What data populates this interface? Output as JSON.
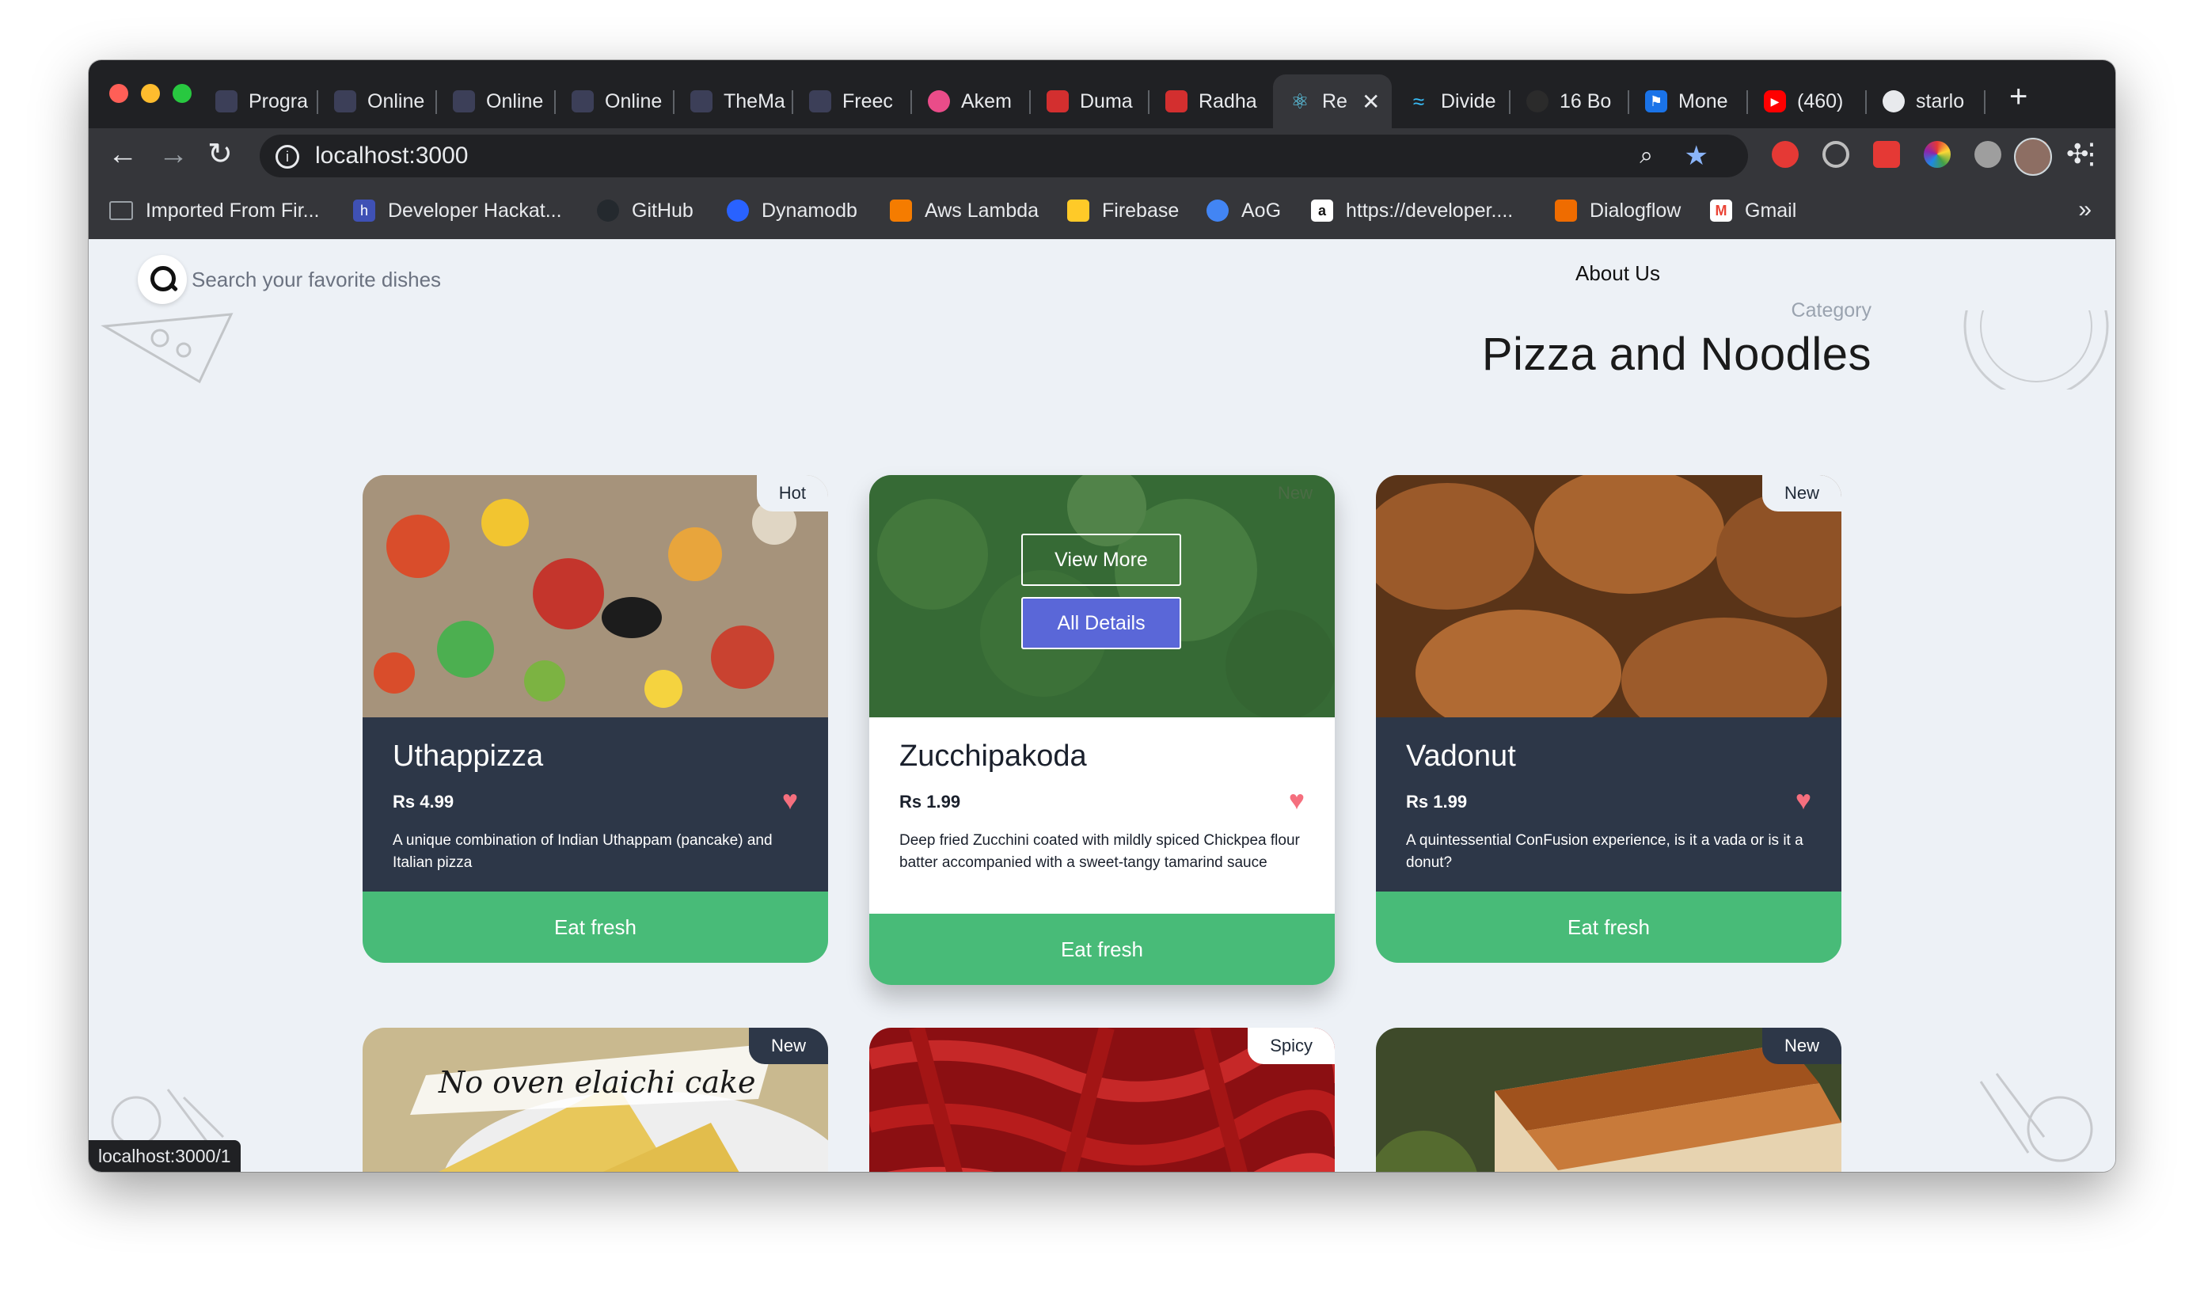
{
  "browser": {
    "tabs": [
      {
        "label": "Progra",
        "favicon": "dark-square-icon",
        "color": "#3c3f58"
      },
      {
        "label": "Online",
        "favicon": "dark-square-icon",
        "color": "#3c3f58"
      },
      {
        "label": "Online",
        "favicon": "dark-square-icon",
        "color": "#3c3f58"
      },
      {
        "label": "Online",
        "favicon": "dark-square-icon",
        "color": "#3c3f58"
      },
      {
        "label": "TheMa",
        "favicon": "dark-square-icon",
        "color": "#3c3f58"
      },
      {
        "label": "Freec",
        "favicon": "dark-square-icon",
        "color": "#3c3f58"
      },
      {
        "label": "Akem",
        "favicon": "dribbble-icon",
        "color": "#ea4c89"
      },
      {
        "label": "Duma",
        "favicon": "red-flag-icon",
        "color": "#d32f2f"
      },
      {
        "label": "Radha",
        "favicon": "red-flag-icon",
        "color": "#d32f2f"
      },
      {
        "label": "Re",
        "favicon": "react-icon",
        "color": "#61dafb",
        "active": true
      },
      {
        "label": "Divide",
        "favicon": "tailwind-icon",
        "color": "#38bdf8"
      },
      {
        "label": "16 Bo",
        "favicon": "dark-circle-icon",
        "color": "#2b2b2b"
      },
      {
        "label": "Mone",
        "favicon": "blue-flag-icon",
        "color": "#1a73e8"
      },
      {
        "label": "(460)",
        "favicon": "youtube-icon",
        "color": "#ff0000"
      },
      {
        "label": "starlo",
        "favicon": "globe-icon",
        "color": "#e8eaed"
      }
    ],
    "url": "localhost:3000",
    "bookmarks": [
      {
        "label": "Imported From Fir...",
        "icon": "folder-icon",
        "color": "#9aa0a6"
      },
      {
        "label": "Developer Hackat...",
        "icon": "hackathon-icon",
        "color": "#3f51b5"
      },
      {
        "label": "GitHub",
        "icon": "github-icon",
        "color": "#24292e"
      },
      {
        "label": "Dynamodb",
        "icon": "dynamodb-icon",
        "color": "#2962ff"
      },
      {
        "label": "Aws Lambda",
        "icon": "aws-lambda-icon",
        "color": "#f57c00"
      },
      {
        "label": "Firebase",
        "icon": "firebase-icon",
        "color": "#ffca28"
      },
      {
        "label": "AoG",
        "icon": "google-assistant-icon",
        "color": "#4285f4"
      },
      {
        "label": "https://developer....",
        "icon": "amazon-icon",
        "color": "#ffffff"
      },
      {
        "label": "Dialogflow",
        "icon": "dialogflow-icon",
        "color": "#ef6c00"
      },
      {
        "label": "Gmail",
        "icon": "gmail-icon",
        "color": "#ea4335"
      }
    ],
    "status_url": "localhost:3000/1"
  },
  "page": {
    "search": {
      "placeholder": "Search your favorite dishes"
    },
    "nav": {
      "about": "About Us"
    },
    "category": {
      "label": "Category",
      "title": "Pizza and Noodles"
    },
    "cards": [
      {
        "name": "Uthappizza",
        "price": "Rs 4.99",
        "badge": "Hot",
        "description": "A unique combination of Indian Uthappam (pancake) and Italian pizza",
        "cta": "Eat fresh",
        "theme": "dark"
      },
      {
        "name": "Zucchipakoda",
        "price": "Rs 1.99",
        "badge": "New",
        "description": "Deep fried Zucchini coated with mildly spiced Chickpea flour batter accompanied with a sweet-tangy tamarind sauce",
        "cta": "Eat fresh",
        "theme": "light",
        "hover": {
          "view_more": "View More",
          "all_details": "All Details"
        }
      },
      {
        "name": "Vadonut",
        "price": "Rs 1.99",
        "badge": "New",
        "description": "A quintessential ConFusion experience, is it a vada or is it a donut?",
        "cta": "Eat fresh",
        "theme": "dark"
      }
    ],
    "cards_row2": [
      {
        "badge": "New",
        "image_caption": "No oven elaichi cake"
      },
      {
        "badge": "Spicy"
      },
      {
        "badge": "New"
      }
    ],
    "colors": {
      "accent_green": "#48bb78",
      "card_dark": "#2d3748",
      "heart": "#f56f7e",
      "button_blue": "#5a67d8"
    }
  }
}
